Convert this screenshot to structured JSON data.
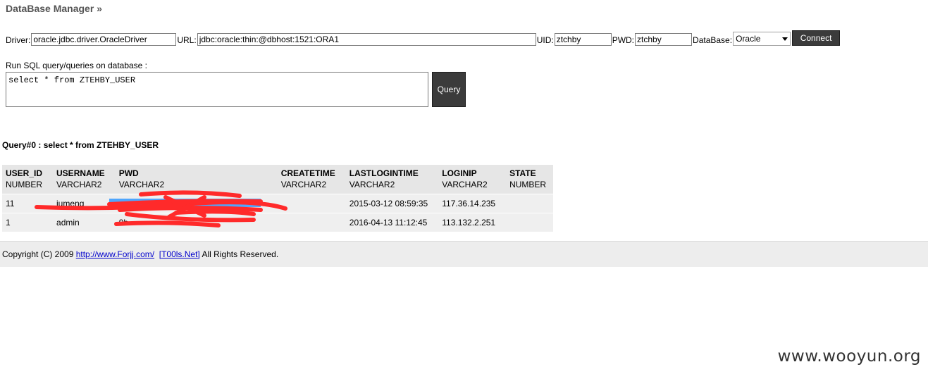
{
  "header": {
    "title": "DataBase Manager »"
  },
  "connection": {
    "driver_label": "Driver:",
    "driver_value": "oracle.jdbc.driver.OracleDriver",
    "url_label": "URL:",
    "url_value": "jdbc:oracle:thin:@dbhost:1521:ORA1",
    "uid_label": "UID:",
    "uid_value": "ztchby",
    "pwd_label": "PWD:",
    "pwd_value": "ztchby",
    "database_label": "DataBase:",
    "database_selected": "Oracle",
    "connect_label": "Connect"
  },
  "query_input": {
    "label": "Run SQL query/queries on database :",
    "sql": "select * from ZTEHBY_USER",
    "button_label": "Query"
  },
  "results": {
    "title": "Query#0 : select * from ZTEHBY_USER",
    "columns": [
      {
        "name": "USER_ID",
        "type": "NUMBER"
      },
      {
        "name": "USERNAME",
        "type": "VARCHAR2"
      },
      {
        "name": "PWD",
        "type": "VARCHAR2"
      },
      {
        "name": "CREATETIME",
        "type": "VARCHAR2"
      },
      {
        "name": "LASTLOGINTIME",
        "type": "VARCHAR2"
      },
      {
        "name": "LOGINIP",
        "type": "VARCHAR2"
      },
      {
        "name": "STATE",
        "type": "NUMBER"
      }
    ],
    "rows": [
      [
        "11",
        "jumeng",
        "",
        "",
        "2015-03-12 08:59:35",
        "117.36.14.235",
        ""
      ],
      [
        "1",
        "admin",
        "9b",
        "",
        "2016-04-13 11:12:45",
        "113.132.2.251",
        ""
      ]
    ]
  },
  "footer": {
    "copyright_prefix": "Copyright (C) 2009 ",
    "link1": "http://www.Forjj.com/",
    "link2": "[T00ls.Net]",
    "suffix": " All Rights Reserved."
  },
  "watermark": "www.wooyun.org",
  "colors": {
    "redaction": "#ff2a2a",
    "selection": "#3399ff",
    "button_bg": "#3b3b3b"
  }
}
